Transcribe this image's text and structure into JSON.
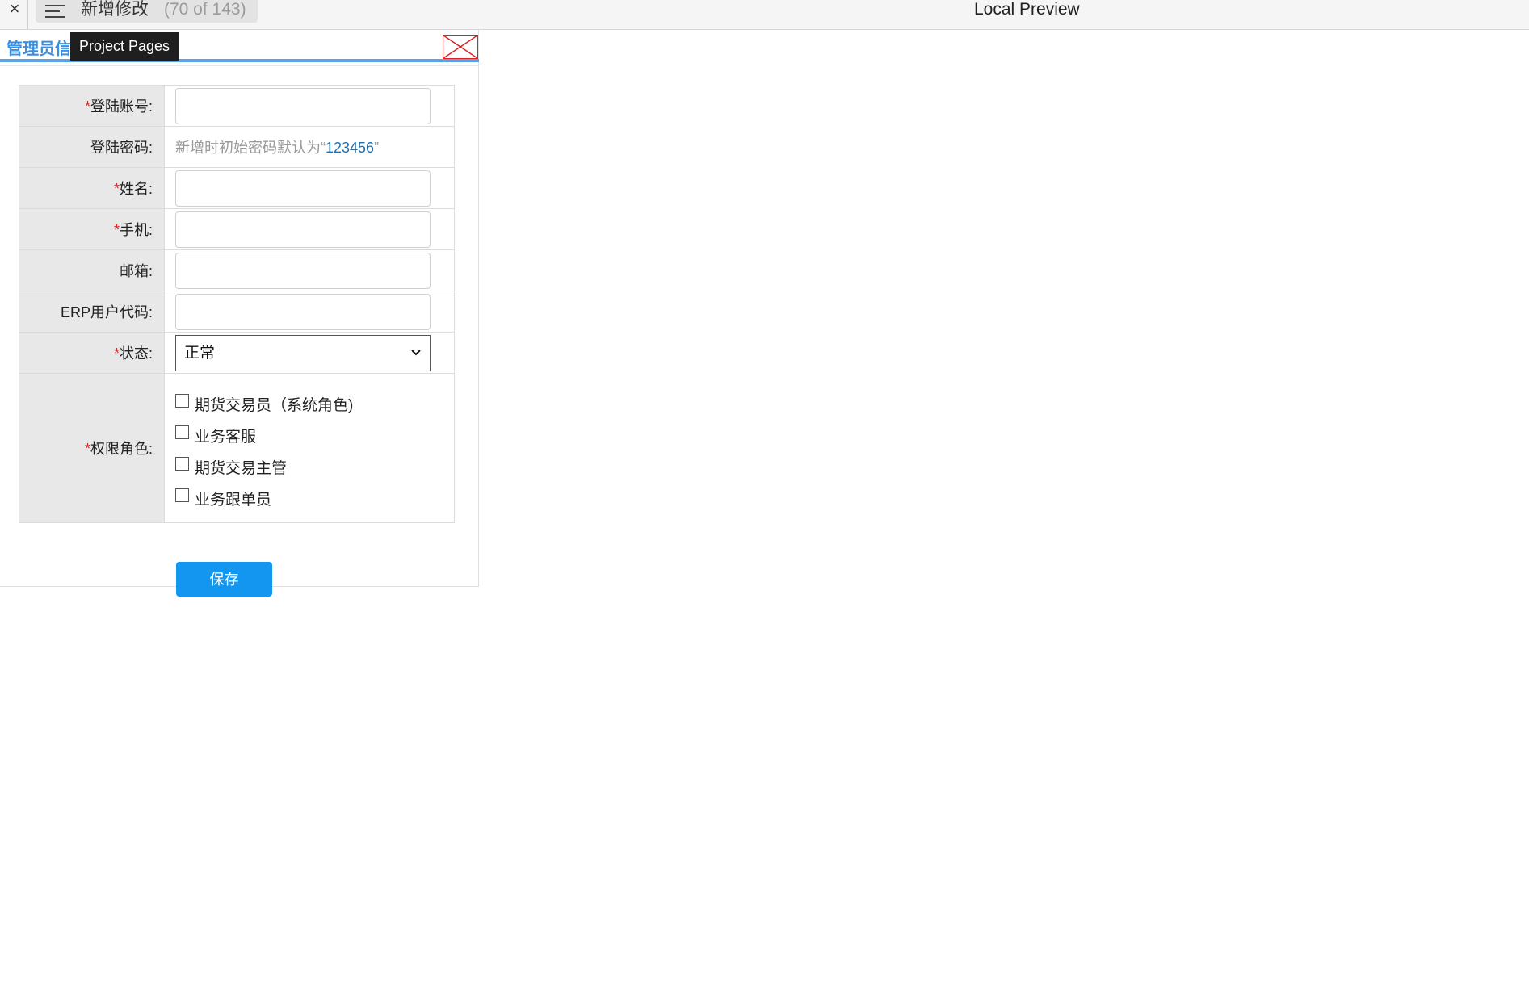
{
  "topbar": {
    "close_glyph": "×",
    "menu_icon": "hamburger-icon",
    "page_name": "新增修改",
    "page_count": "(70 of 143)",
    "preview_title": "Local Preview"
  },
  "panel": {
    "title": "管理员信",
    "tooltip": "Project Pages",
    "broken_image_icon": "broken-image-icon"
  },
  "form": {
    "required_mark": "*",
    "fields": {
      "login_account": {
        "label": "登陆账号:",
        "value": "",
        "required": true
      },
      "login_password": {
        "label": "登陆密码:",
        "hint_prefix": "新增时初始密码默认为“",
        "hint_value": "123456",
        "hint_suffix": "”"
      },
      "name": {
        "label": "姓名:",
        "value": "",
        "required": true
      },
      "mobile": {
        "label": "手机:",
        "value": "",
        "required": true
      },
      "email": {
        "label": "邮箱:",
        "value": ""
      },
      "erp_code": {
        "label": "ERP用户代码:",
        "value": ""
      },
      "status": {
        "label": "状态:",
        "selected": "正常",
        "required": true
      },
      "roles": {
        "label": "权限角色:",
        "required": true,
        "items": [
          {
            "label": "期货交易员（系统角色)",
            "checked": false
          },
          {
            "label": "业务客服",
            "checked": false
          },
          {
            "label": "期货交易主管",
            "checked": false
          },
          {
            "label": "业务跟单员",
            "checked": false
          }
        ]
      }
    },
    "save_label": "保存",
    "accent_color": "#1296f0",
    "required_color": "#e02020"
  }
}
